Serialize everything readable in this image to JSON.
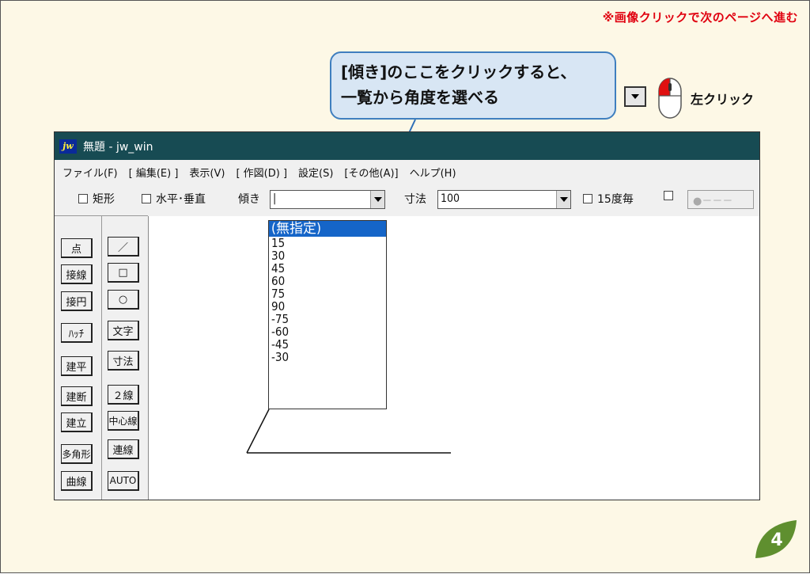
{
  "slide": {
    "next_hint": "※画像クリックで次のページへ進む",
    "callout_line1": "[傾き]のここをクリックすると、",
    "callout_line2": "一覧から角度を選べる",
    "left_click_label": "左クリック",
    "page_number": "4",
    "accent_color": "#5f8f2f"
  },
  "app": {
    "logo": "jw",
    "title": "無題 - jw_win",
    "menu": [
      "ファイル(F)",
      "[ 編集(E) ]",
      "表示(V)",
      "[ 作図(D) ]",
      "設定(S)",
      "[その他(A)]",
      "ヘルプ(H)"
    ],
    "toolbar": {
      "rect_label": "矩形",
      "horiz_vert_label": "水平･垂直",
      "tilt_label": "傾き",
      "tilt_value": "|",
      "dim_label": "寸法",
      "dim_value": "100",
      "deg15_label": "15度毎",
      "pen_label": "●－－－"
    },
    "tools_left": [
      "点",
      "接線",
      "接円",
      "ﾊｯﾁ",
      "建平",
      "建断",
      "建立",
      "多角形",
      "曲線"
    ],
    "tools_right": [
      "／",
      "□",
      "○",
      "文字",
      "寸法",
      "２線",
      "中心線",
      "連線",
      "AUTO"
    ],
    "tilt_options": [
      "(無指定)",
      "15",
      "30",
      "45",
      "60",
      "75",
      "90",
      "-75",
      "-60",
      "-45",
      "-30"
    ],
    "selected_option": "(無指定)"
  }
}
